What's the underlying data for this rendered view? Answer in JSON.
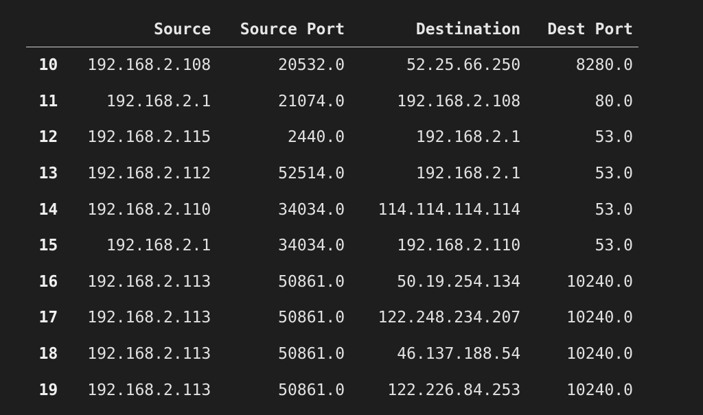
{
  "table": {
    "columns": [
      "",
      "Source",
      "Source Port",
      "Destination",
      "Dest Port"
    ],
    "rows": [
      {
        "index": "10",
        "source": "192.168.2.108",
        "source_port": "20532.0",
        "destination": "52.25.66.250",
        "dest_port": "8280.0"
      },
      {
        "index": "11",
        "source": "192.168.2.1",
        "source_port": "21074.0",
        "destination": "192.168.2.108",
        "dest_port": "80.0"
      },
      {
        "index": "12",
        "source": "192.168.2.115",
        "source_port": "2440.0",
        "destination": "192.168.2.1",
        "dest_port": "53.0"
      },
      {
        "index": "13",
        "source": "192.168.2.112",
        "source_port": "52514.0",
        "destination": "192.168.2.1",
        "dest_port": "53.0"
      },
      {
        "index": "14",
        "source": "192.168.2.110",
        "source_port": "34034.0",
        "destination": "114.114.114.114",
        "dest_port": "53.0"
      },
      {
        "index": "15",
        "source": "192.168.2.1",
        "source_port": "34034.0",
        "destination": "192.168.2.110",
        "dest_port": "53.0"
      },
      {
        "index": "16",
        "source": "192.168.2.113",
        "source_port": "50861.0",
        "destination": "50.19.254.134",
        "dest_port": "10240.0"
      },
      {
        "index": "17",
        "source": "192.168.2.113",
        "source_port": "50861.0",
        "destination": "122.248.234.207",
        "dest_port": "10240.0"
      },
      {
        "index": "18",
        "source": "192.168.2.113",
        "source_port": "50861.0",
        "destination": "46.137.188.54",
        "dest_port": "10240.0"
      },
      {
        "index": "19",
        "source": "192.168.2.113",
        "source_port": "50861.0",
        "destination": "122.226.84.253",
        "dest_port": "10240.0"
      }
    ]
  },
  "colors": {
    "background": "#1e1e1e",
    "text": "#e2e2e2",
    "header_rule": "#cfcfcf"
  }
}
